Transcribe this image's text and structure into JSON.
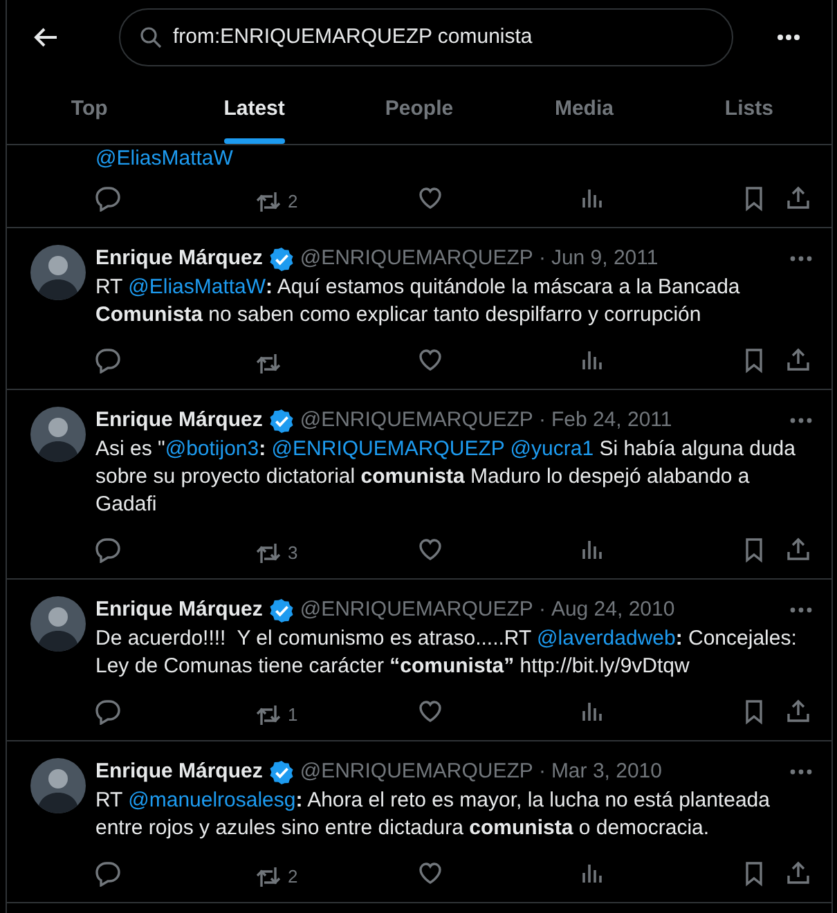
{
  "header": {
    "search": {
      "value": "from:ENRIQUEMARQUEZP comunista"
    }
  },
  "tabs": [
    {
      "label": "Top",
      "selected": false
    },
    {
      "label": "Latest",
      "selected": true
    },
    {
      "label": "People",
      "selected": false
    },
    {
      "label": "Media",
      "selected": false
    },
    {
      "label": "Lists",
      "selected": false
    }
  ],
  "timeline": [
    {
      "kind": "continuation",
      "text": [
        {
          "kind": "mention",
          "text": "@EliasMattaW"
        }
      ],
      "retweets": "2"
    },
    {
      "kind": "tweet",
      "name": "Enrique Márquez",
      "verified": true,
      "handle": "@ENRIQUEMARQUEZP",
      "dot": "·",
      "date": "Jun 9, 2011",
      "text": [
        {
          "kind": "text",
          "text": "RT "
        },
        {
          "kind": "mention",
          "text": "@EliasMattaW"
        },
        {
          "kind": "bold",
          "text": ":"
        },
        {
          "kind": "text",
          "text": " Aquí estamos quitándole la máscara a la Bancada "
        },
        {
          "kind": "bold",
          "text": "Comunista"
        },
        {
          "kind": "text",
          "text": " no saben como explicar tanto despilfarro y corrupción"
        }
      ]
    },
    {
      "kind": "tweet",
      "name": "Enrique Márquez",
      "verified": true,
      "handle": "@ENRIQUEMARQUEZP",
      "dot": "·",
      "date": "Feb 24, 2011",
      "text": [
        {
          "kind": "text",
          "text": "Asi es \""
        },
        {
          "kind": "mention",
          "text": "@botijon3"
        },
        {
          "kind": "bold",
          "text": ":"
        },
        {
          "kind": "mention",
          "text": "@ENRIQUEMARQUEZP",
          "space_before": true
        },
        {
          "kind": "mention",
          "text": "@yucra1",
          "space_before": true
        },
        {
          "kind": "text",
          "text": " Si había alguna duda sobre su proyecto dictatorial "
        },
        {
          "kind": "bold",
          "text": "comunista"
        },
        {
          "kind": "text",
          "text": " Maduro lo despejó alabando a Gadafi"
        }
      ],
      "retweets": "3"
    },
    {
      "kind": "tweet",
      "name": "Enrique Márquez",
      "verified": true,
      "handle": "@ENRIQUEMARQUEZP",
      "dot": "·",
      "date": "Aug 24, 2010",
      "text": [
        {
          "kind": "text",
          "text": "De acuerdo!!!!  Y el comunismo es atraso.....RT "
        },
        {
          "kind": "mention",
          "text": "@laverdadweb"
        },
        {
          "kind": "bold",
          "text": ":"
        },
        {
          "kind": "text",
          "text": " Concejales: Ley de Comunas tiene carácter "
        },
        {
          "kind": "bold",
          "text": "“comunista”"
        },
        {
          "kind": "text",
          "text": " http://bit.ly/9vDtqw"
        }
      ],
      "retweets": "1"
    },
    {
      "kind": "tweet",
      "name": "Enrique Márquez",
      "verified": true,
      "handle": "@ENRIQUEMARQUEZP",
      "dot": "·",
      "date": "Mar 3, 2010",
      "text": [
        {
          "kind": "text",
          "text": "RT "
        },
        {
          "kind": "mention",
          "text": "@manuelrosalesg"
        },
        {
          "kind": "bold",
          "text": ":"
        },
        {
          "kind": "text",
          "text": " Ahora el reto es mayor, la lucha no está planteada entre rojos y azules sino entre dictadura "
        },
        {
          "kind": "bold",
          "text": "comunista"
        },
        {
          "kind": "text",
          "text": " o democracia."
        }
      ],
      "retweets": "2"
    }
  ]
}
